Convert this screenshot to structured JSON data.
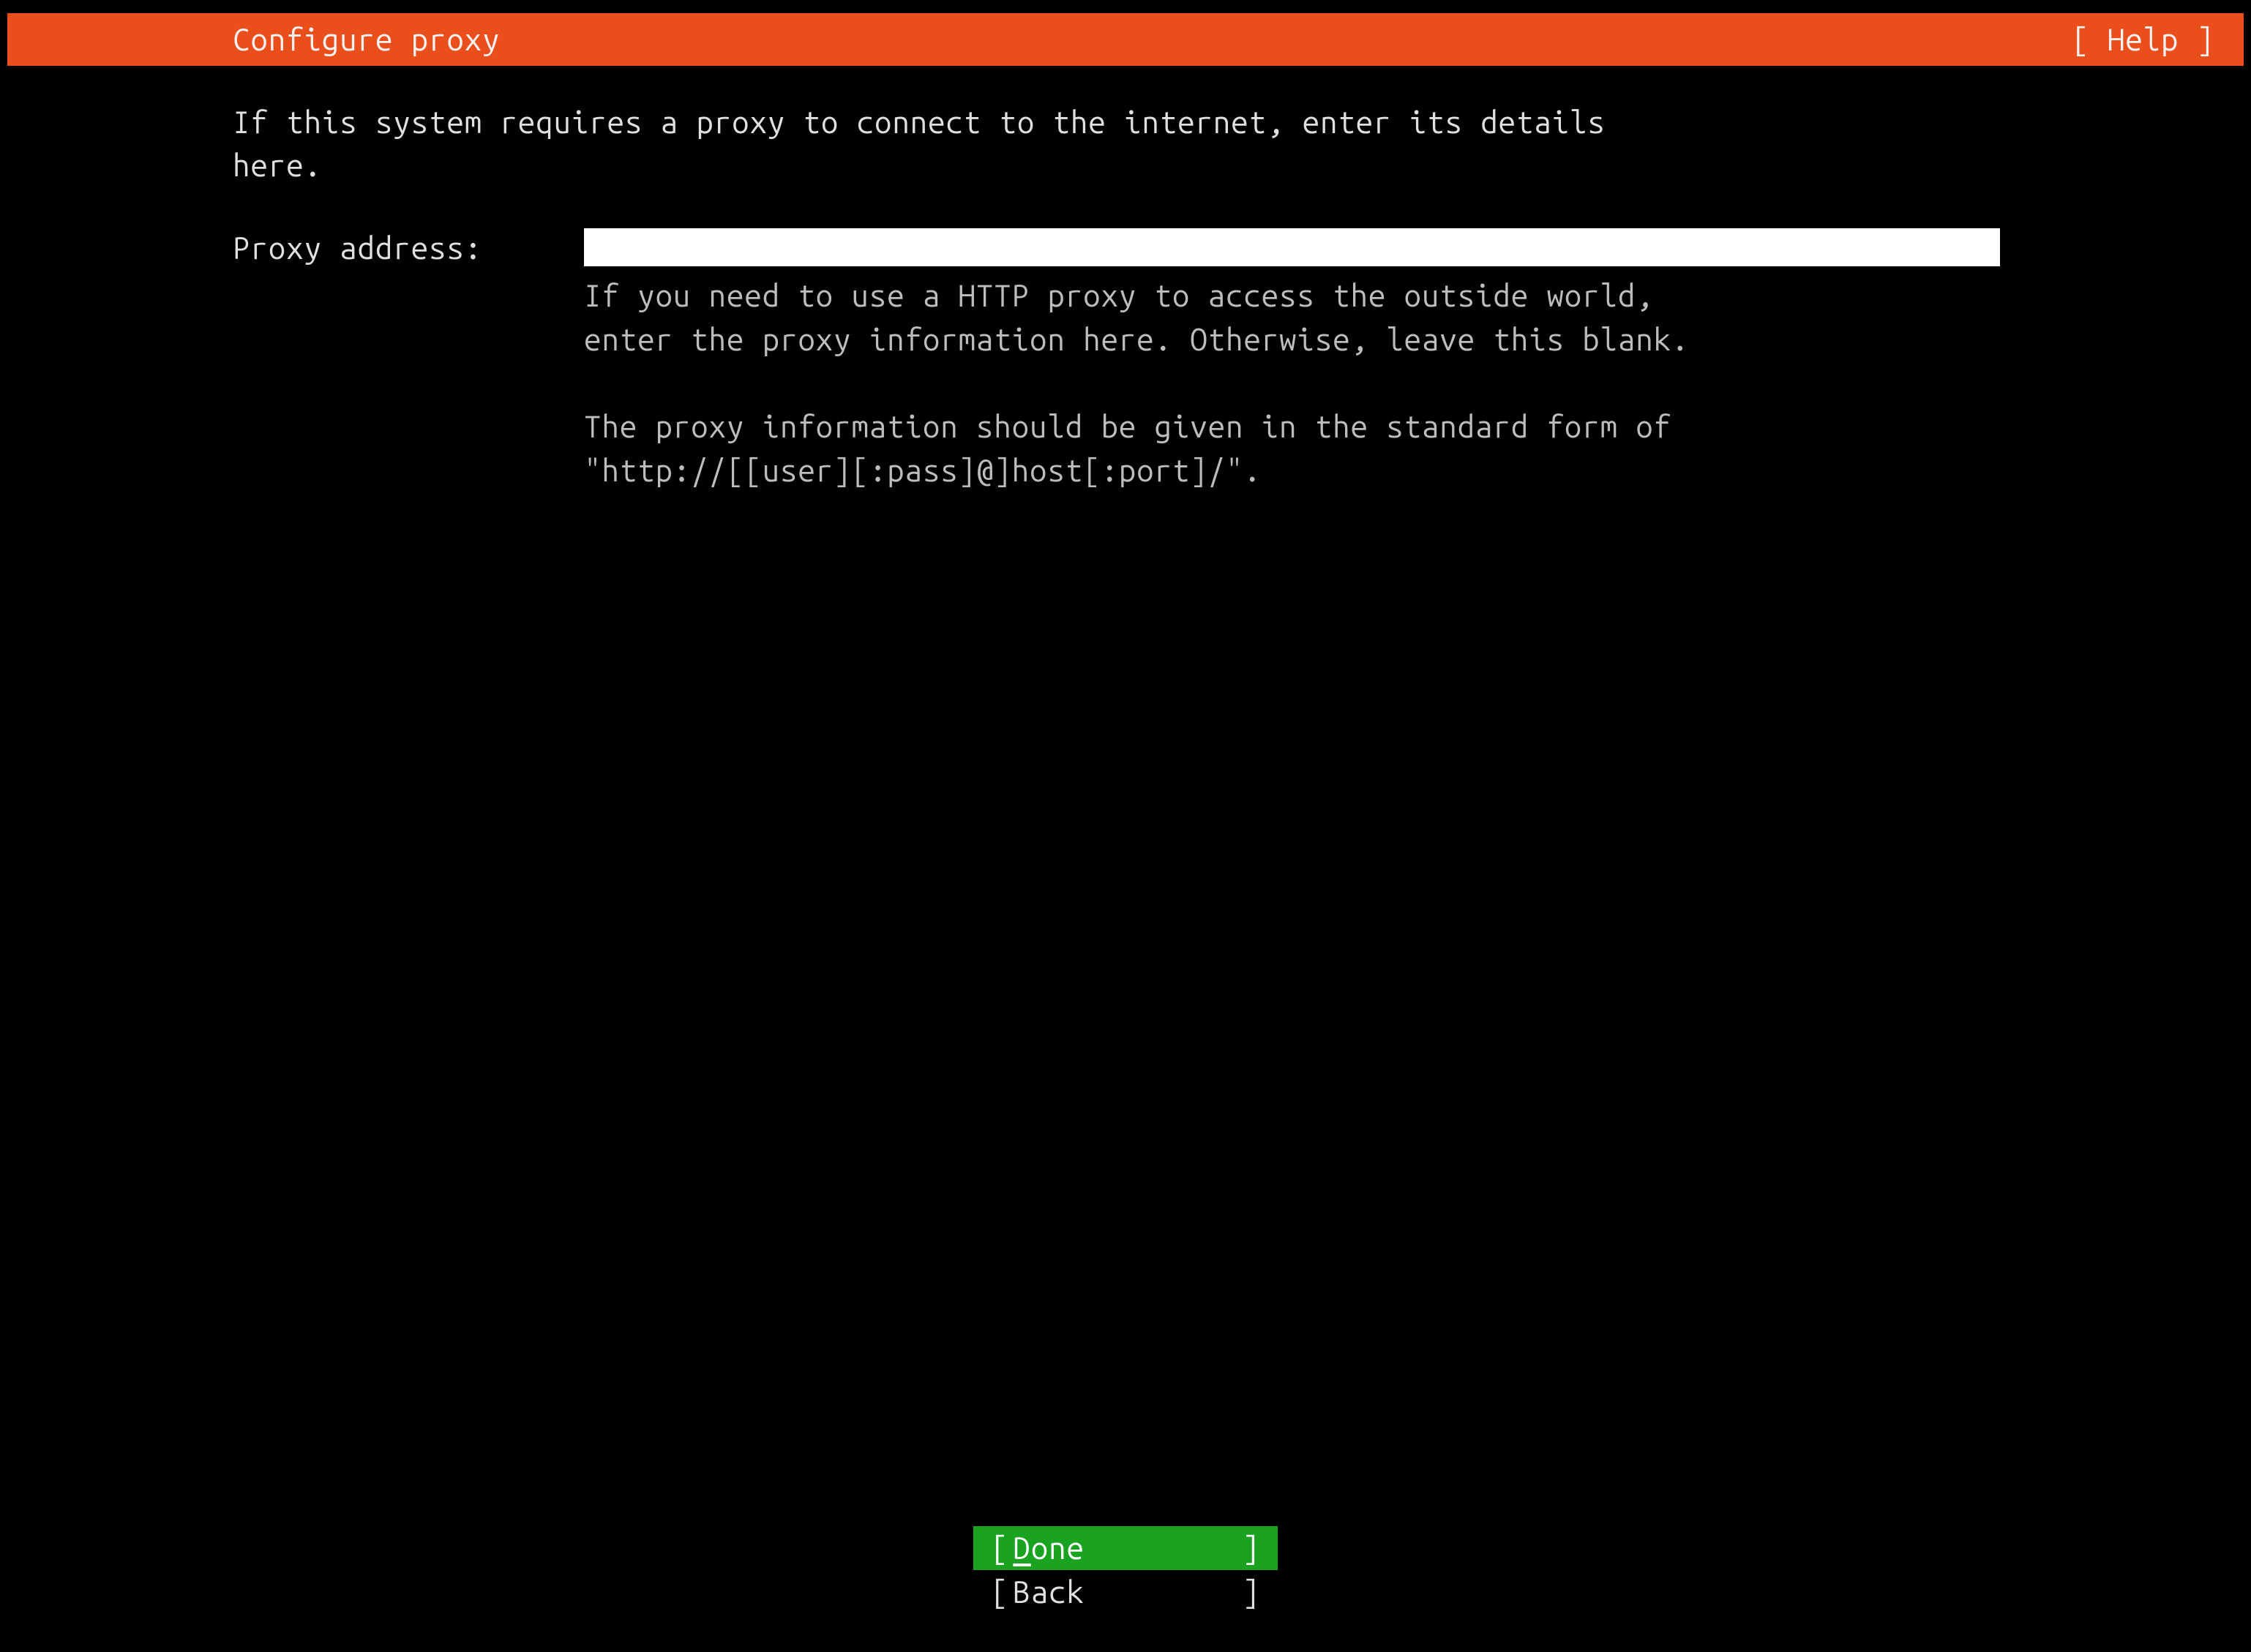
{
  "header": {
    "title": "Configure proxy",
    "help_label": "[ Help ]"
  },
  "content": {
    "intro": "If this system requires a proxy to connect to the internet, enter its details\nhere.",
    "field_label": "Proxy address:",
    "proxy_value": "",
    "help_text": "If you need to use a HTTP proxy to access the outside world,\nenter the proxy information here. Otherwise, leave this blank.\n\nThe proxy information should be given in the standard form of\n\"http://[[user][:pass]@]host[:port]/\"."
  },
  "footer": {
    "done_bracket_left": "[",
    "done_bracket_right": "]",
    "done_first_char": "D",
    "done_rest": "one",
    "back_bracket_left": "[",
    "back_bracket_right": "]",
    "back_label": "Back"
  },
  "colors": {
    "header_bg": "#e94e1b",
    "done_bg": "#1aa321",
    "background": "#000000",
    "text": "#e0e0e0",
    "help_text": "#bdbdbd",
    "input_bg": "#ffffff"
  }
}
